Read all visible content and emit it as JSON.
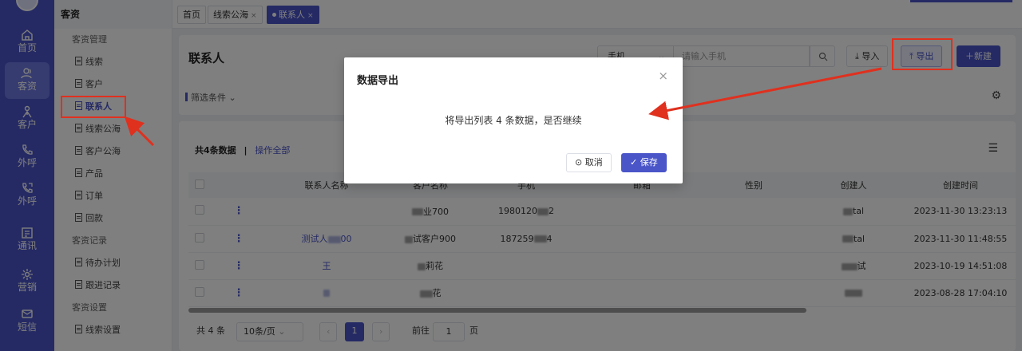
{
  "rail": {
    "items": [
      {
        "label": "首页",
        "icon": "home-icon"
      },
      {
        "label": "客资",
        "icon": "users-icon",
        "active": true
      },
      {
        "label": "客户",
        "icon": "person-icon"
      },
      {
        "label": "外呼",
        "icon": "phone-icon"
      },
      {
        "label": "外呼",
        "icon": "phone-out-icon"
      },
      {
        "label": "通讯",
        "icon": "calendar-icon"
      },
      {
        "label": "营销",
        "icon": "gear-flower-icon"
      },
      {
        "label": "短信",
        "icon": "message-icon"
      }
    ]
  },
  "sidebar": {
    "title": "客资",
    "groups": [
      {
        "label": "客资管理",
        "items": [
          "线索",
          "客户",
          "联系人",
          "线索公海",
          "客户公海",
          "产品",
          "订单",
          "回款"
        ]
      },
      {
        "label": "客资记录",
        "items": [
          "待办计划",
          "跟进记录"
        ]
      },
      {
        "label": "客资设置",
        "items": [
          "线索设置"
        ]
      }
    ],
    "active_item": "联系人"
  },
  "tabs": [
    {
      "label": "首页"
    },
    {
      "label": "线索公海",
      "close": "×"
    },
    {
      "label": "联系人",
      "close": "×",
      "active": true
    }
  ],
  "page": {
    "title": "联系人",
    "search_field": "手机",
    "search_placeholder": "请输入手机",
    "import_label": "导入",
    "export_label": "导出",
    "new_label": "新建",
    "filter_label": "筛选条件",
    "count_text": "共4条数据",
    "separator": "|",
    "operate_all": "操作全部"
  },
  "table": {
    "columns": [
      "联系人名称",
      "客户名称",
      "手机",
      "邮箱",
      "性别",
      "创建人",
      "创建时间"
    ],
    "rows": [
      {
        "name": "",
        "customer": "业700",
        "phone": "1980120",
        "phone_tail": "2",
        "creator": "tal",
        "created": "2023-11-30 13:23:13"
      },
      {
        "name": "测试人",
        "name_tail": "00",
        "customer": "试客户900",
        "phone": "187259",
        "phone_tail": "4",
        "creator": "tal",
        "created": "2023-11-30 11:48:55"
      },
      {
        "name": "王",
        "customer": "莉花",
        "phone": "",
        "creator": "试",
        "created": "2023-10-19 14:51:08"
      },
      {
        "name": "",
        "customer": "花",
        "phone": "",
        "creator": "",
        "created": "2023-08-28 17:04:10"
      }
    ]
  },
  "pager": {
    "total": "共 4 条",
    "page_size": "10条/页",
    "prev": "‹",
    "current": "1",
    "next": "›",
    "goto_label": "前往",
    "goto_value": "1",
    "page_unit": "页"
  },
  "modal": {
    "title": "数据导出",
    "message": "将导出列表 4 条数据，是否继续",
    "cancel_label": "取消",
    "save_label": "保存",
    "close": "×"
  },
  "colors": {
    "brand": "#4a55c8",
    "annotation": "#e0301e"
  }
}
